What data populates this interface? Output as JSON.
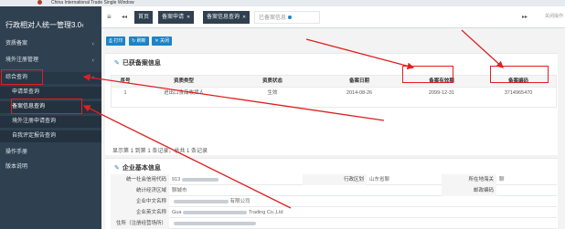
{
  "window": {
    "title": "China International Trade Single Window"
  },
  "sidebar": {
    "title": "行政相对人统一管理3.0",
    "title_arrow": "‹",
    "items": [
      {
        "label": "资质备案",
        "arrow": "‹"
      },
      {
        "label": "境外注册管理",
        "arrow": "‹"
      },
      {
        "label": "综合查询",
        "arrow": "‹"
      },
      {
        "label": "操作手册"
      },
      {
        "label": "版本说明"
      }
    ],
    "subitems": [
      {
        "label": "申请单查询"
      },
      {
        "label": "备案信息查询"
      },
      {
        "label": "境外注册申请查询"
      },
      {
        "label": "自我评定报告查询"
      }
    ]
  },
  "tabsbar": {
    "menu_icon": "≡",
    "back_icon": "◂◂",
    "tabs": [
      {
        "label": "首页"
      },
      {
        "label": "备案申请"
      },
      {
        "label": "备案信息查询"
      },
      {
        "label": "已备案信息"
      }
    ],
    "forward_icon": "▸▸",
    "close_ops": "关闭操作"
  },
  "toolbar": {
    "buttons": [
      "打印",
      "刷新",
      "关闭"
    ]
  },
  "records": {
    "title": "已获备案信息",
    "headers": [
      "序号",
      "资质类型",
      "资质状态",
      "备案日期",
      "备案有效期",
      "备案编码"
    ],
    "rows": [
      [
        "1",
        "进出口食品收货人",
        "生效",
        "2014-08-26",
        "2099-12-31",
        "3714965470"
      ]
    ],
    "pager": "显示第 1 到第 1 条记录，总共 1 条记录"
  },
  "company": {
    "title": "企业基本信息",
    "fields": [
      {
        "l1": "统一社会信用代码",
        "v1": "913",
        "l2": "行政区划",
        "v2": "山东省聊",
        "l3": "所在地海关",
        "v3": "聊"
      },
      {
        "l1": "统计经济区域",
        "v1": "聊城市",
        "l2": "",
        "v2": "",
        "l3": "邮政编码",
        "v3": ""
      },
      {
        "l1": "企业中文名称",
        "v1": "",
        "v1b": "有限公司"
      },
      {
        "l1": "企业英文名称",
        "v1": "Gua",
        "v1b": "Trading Co.,Ltd"
      },
      {
        "l1": "住所（注册经营场所）",
        "v1": ""
      }
    ]
  },
  "colors": {
    "sidebar_bg": "#2f4050",
    "accent": "#1c84c6",
    "annotation": "#e02020"
  }
}
